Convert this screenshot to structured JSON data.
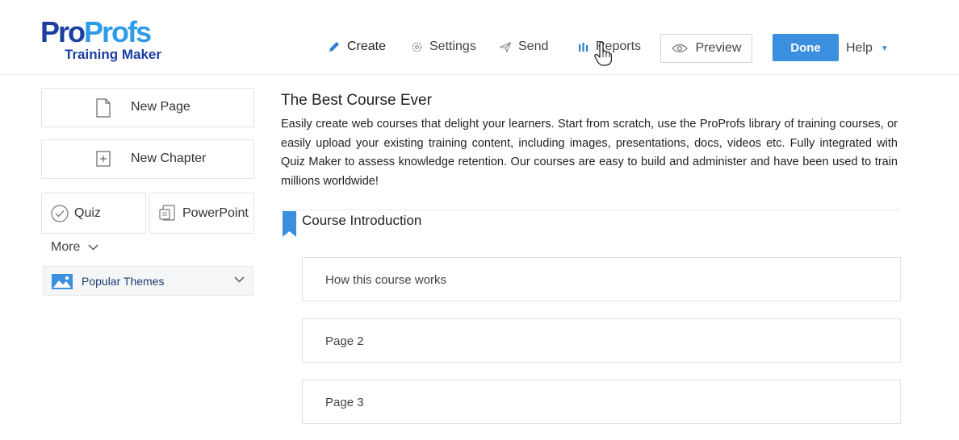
{
  "logo": {
    "brand_part1": "Pro",
    "brand_part2": "Profs",
    "subtitle": "Training Maker"
  },
  "nav": {
    "create": {
      "label": "Create",
      "icon": "pencil-icon"
    },
    "settings": {
      "label": "Settings",
      "icon": "gear-icon"
    },
    "send": {
      "label": "Send",
      "icon": "paper-plane-icon"
    },
    "reports": {
      "label": "Reports",
      "icon": "bar-chart-icon"
    }
  },
  "header_actions": {
    "preview_label": "Preview",
    "done_label": "Done",
    "help_label": "Help"
  },
  "sidebar": {
    "new_page_label": "New Page",
    "new_chapter_label": "New Chapter",
    "quiz_label": "Quiz",
    "powerpoint_label": "PowerPoint",
    "more_label": "More",
    "themes_label": "Popular Themes"
  },
  "course": {
    "title": "The Best Course Ever",
    "description": "Easily create web courses that delight your learners. Start from scratch, use the ProProfs library of training courses, or easily upload your existing training content, including images, presentations, docs, videos etc. Fully integrated with Quiz Maker to assess knowledge retention. Our courses are easy to build and administer and have been used to train millions worldwide!",
    "chapter_title": "Course Introduction",
    "pages": [
      "How this course works",
      "Page 2",
      "Page 3"
    ]
  },
  "colors": {
    "accent": "#3a8fde",
    "brand_dark": "#1b3fa0",
    "brand_light": "#2d9be8"
  }
}
